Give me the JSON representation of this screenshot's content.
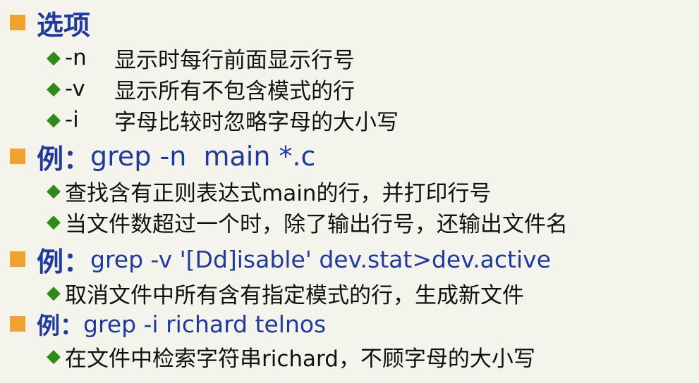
{
  "colors": {
    "background": "#f4f4ec",
    "bullet_square": "#f0a22e",
    "bullet_diamond": "#2b8c18",
    "heading": "#1f3a9e",
    "body_text": "#111111"
  },
  "icons": {
    "level1": "orange-square-bullet-icon",
    "level2": "green-diamond-bullet-icon"
  },
  "diamond_glyph": "◆",
  "section_options": {
    "heading": "选项",
    "items": [
      {
        "flag": "-n",
        "desc": "显示时每行前面显示行号"
      },
      {
        "flag": "-v",
        "desc": "显示所有不包含模式的行"
      },
      {
        "flag": "-i",
        "desc": "字母比较时忽略字母的大小写"
      }
    ]
  },
  "example1": {
    "label": "例：",
    "command": "grep -n  main *.c",
    "notes": [
      "查找含有正则表达式main的行，并打印行号",
      "当文件数超过一个时，除了输出行号，还输出文件名"
    ]
  },
  "example2": {
    "label": "例：",
    "command": "grep -v '[Dd]isable' dev.stat>dev.active",
    "notes": [
      "取消文件中所有含有指定模式的行，生成新文件"
    ]
  },
  "example3": {
    "label": "例：",
    "command": "grep -i richard telnos",
    "notes": [
      "在文件中检索字符串richard，不顾字母的大小写"
    ]
  }
}
